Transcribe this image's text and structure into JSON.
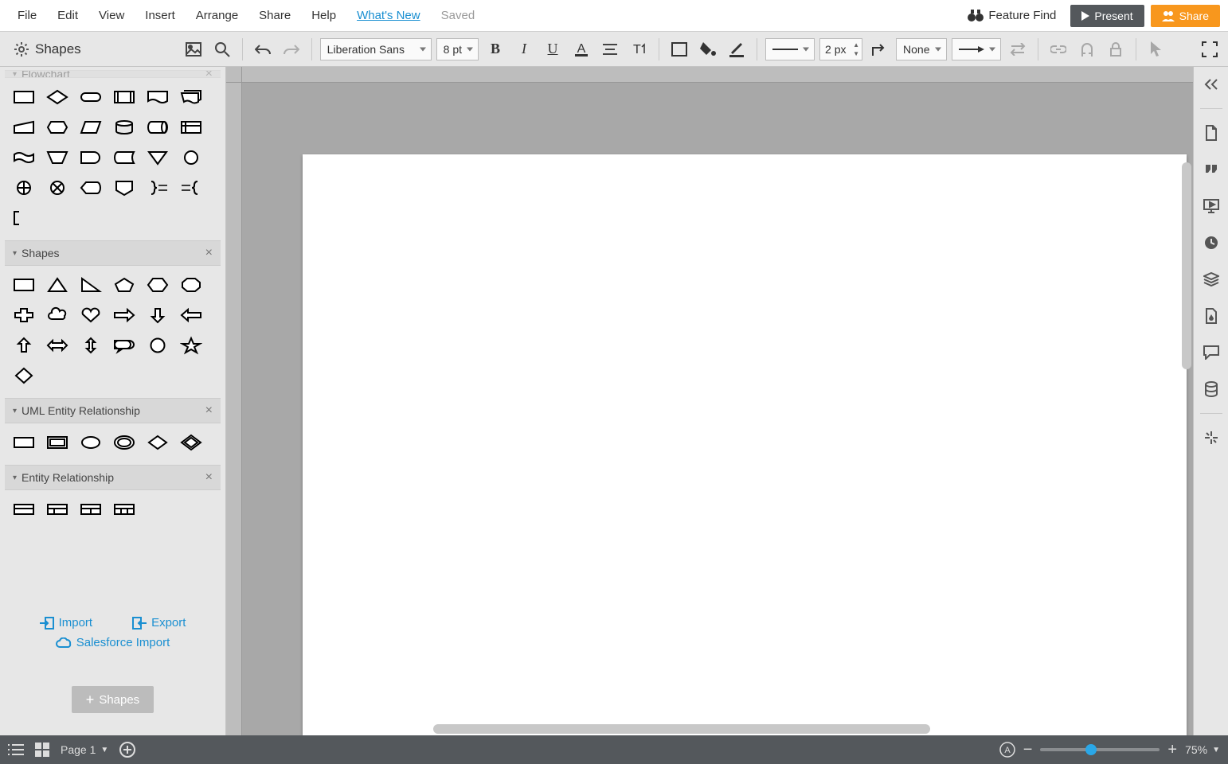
{
  "menubar": {
    "items": [
      "File",
      "Edit",
      "View",
      "Insert",
      "Arrange",
      "Share",
      "Help"
    ],
    "whatsnew": "What's New",
    "saved": "Saved",
    "feature_find": "Feature Find",
    "present": "Present",
    "share": "Share"
  },
  "toolbar": {
    "shapes_label": "Shapes",
    "font_family": "Liberation Sans",
    "font_size": "8 pt",
    "line_width": "2 px",
    "line_end": "None"
  },
  "left": {
    "truncated_header": "Flowchart",
    "cat_shapes": "Shapes",
    "cat_uml": "UML Entity Relationship",
    "cat_er": "Entity Relationship",
    "import": "Import",
    "export": "Export",
    "salesforce": "Salesforce Import",
    "more_shapes": "Shapes"
  },
  "bottom": {
    "page_label": "Page 1",
    "zoom_label": "75%"
  }
}
